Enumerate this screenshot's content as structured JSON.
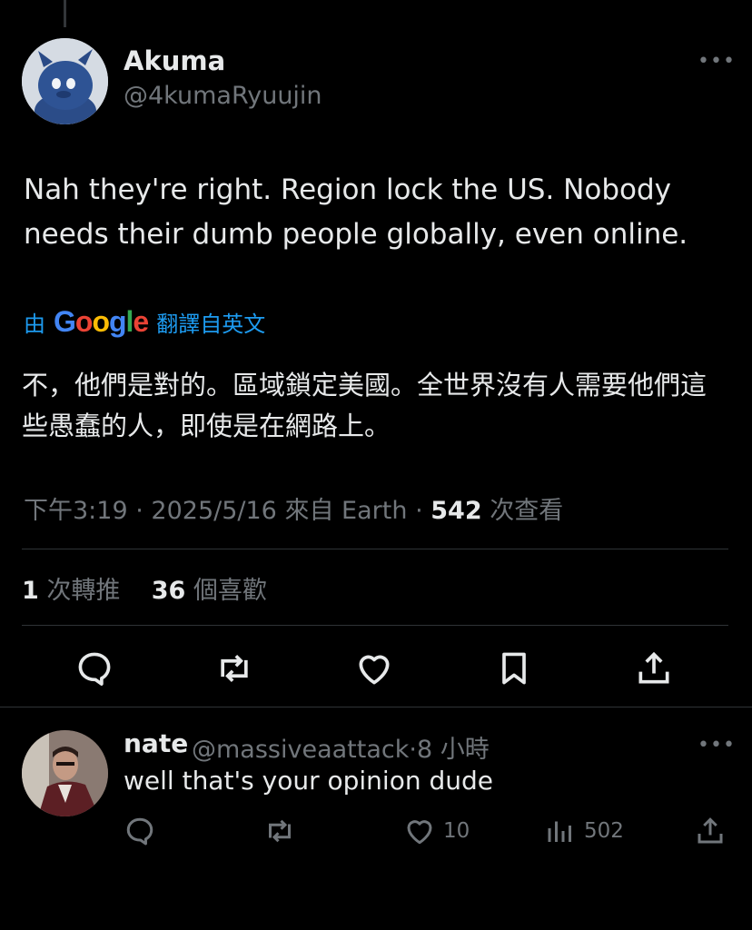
{
  "tweet": {
    "display_name": "Akuma",
    "handle": "@4kumaRyuujin",
    "more_label": "•••",
    "text": "Nah they're right. Region lock the US. Nobody needs their dumb people globally, even online.",
    "translation": {
      "by_label": "由",
      "logo_letters": [
        "G",
        "o",
        "o",
        "g",
        "l",
        "e"
      ],
      "label": "翻譯自英文",
      "text": "不，他們是對的。區域鎖定美國。全世界沒有人需要他們這些愚蠢的人，即使是在網路上。"
    },
    "meta": {
      "time": "下午3:19",
      "date": "2025/5/16",
      "location": "來自 Earth",
      "views_count": "542",
      "views_label": "次查看",
      "separator": "·"
    },
    "stats": {
      "reposts_count": "1",
      "reposts_label": "次轉推",
      "likes_count": "36",
      "likes_label": "個喜歡"
    },
    "actions": [
      "reply-icon",
      "repost-icon",
      "like-icon",
      "bookmark-icon",
      "share-icon"
    ]
  },
  "reply": {
    "display_name": "nate",
    "handle": "@massiveaattack",
    "time": "8 小時",
    "separator": "·",
    "more_label": "•••",
    "text": "well that's your opinion dude",
    "likes_count": "10",
    "views_count": "502"
  },
  "colors": {
    "background": "#000000",
    "text": "#e7e9ea",
    "muted": "#71767b",
    "accent": "#1d9bf0",
    "divider": "#2f3336"
  }
}
